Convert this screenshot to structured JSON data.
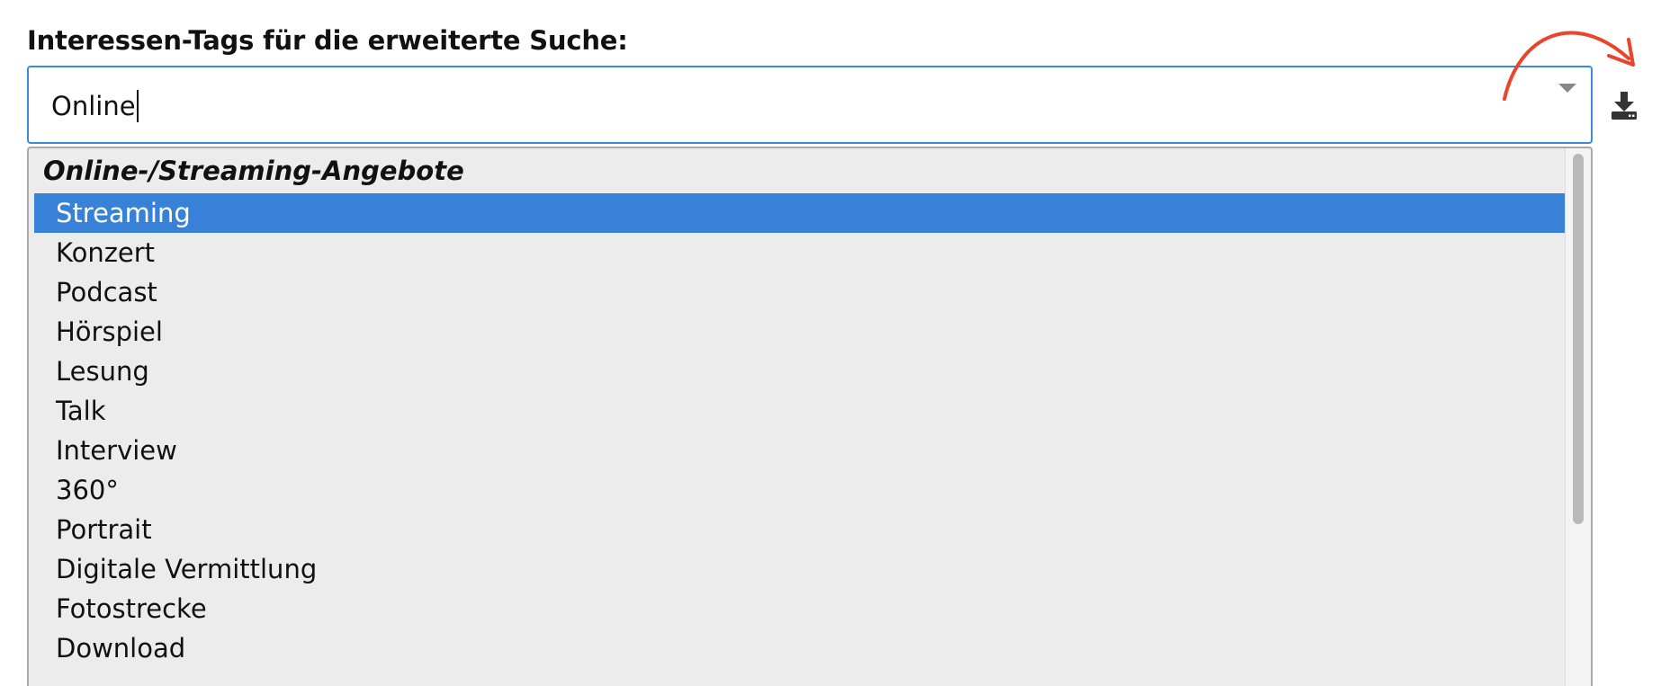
{
  "form": {
    "label": "Interessen-Tags für die erweiterte Suche:",
    "input_value": "Online"
  },
  "dropdown": {
    "group_label": "Online-/Streaming-Angebote",
    "highlighted_index": 0,
    "options": [
      "Streaming",
      "Konzert",
      "Podcast",
      "Hörspiel",
      "Lesung",
      "Talk",
      "Interview",
      "360°",
      "Portrait",
      "Digitale Vermittlung",
      "Fotostrecke",
      "Download"
    ],
    "scroll_fraction_visible": 0.69
  },
  "icons": {
    "dropdown_toggle": "chevron-down-icon",
    "download": "download-icon",
    "annotation": "red-curved-arrow-icon"
  },
  "colors": {
    "focus_border": "#3c8bd6",
    "highlight": "#3781d8",
    "panel_background": "#ececec",
    "annotation_arrow": "#e8452c"
  }
}
